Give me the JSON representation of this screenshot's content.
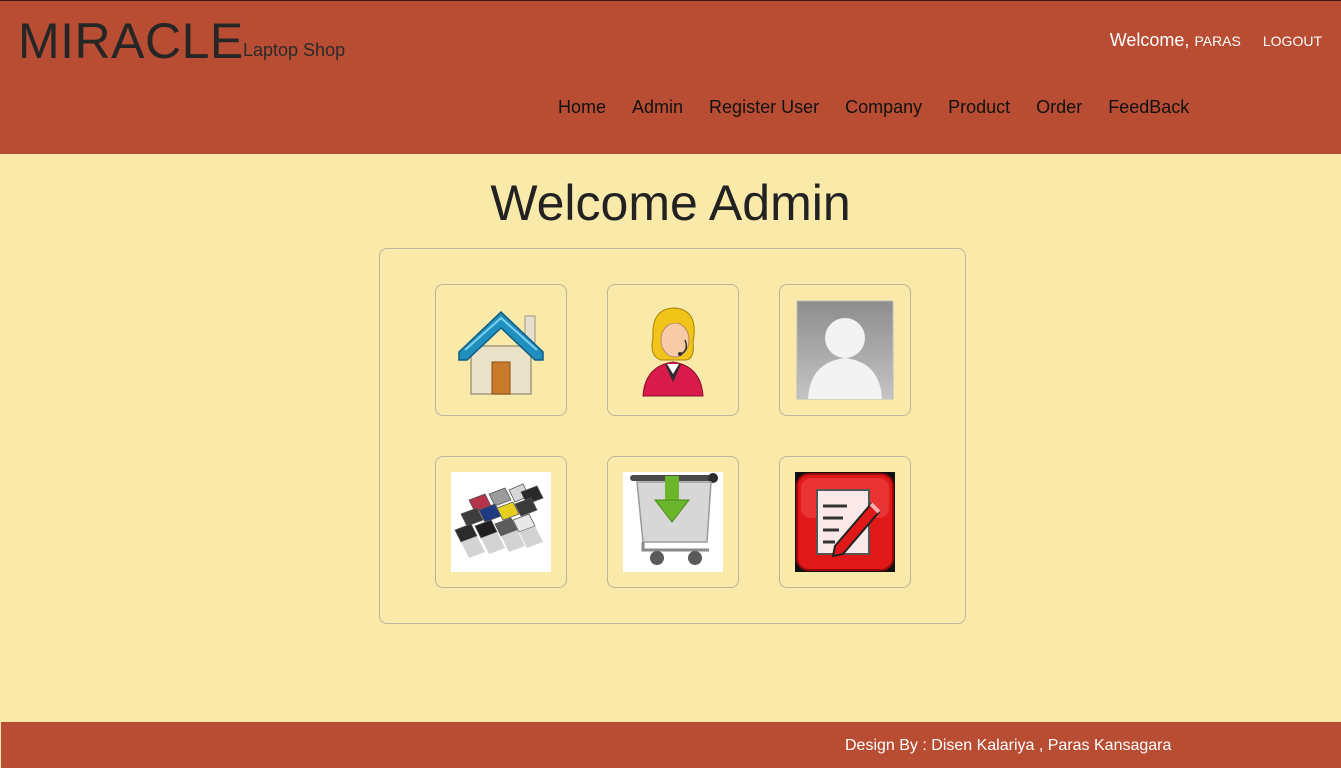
{
  "header": {
    "brand": "MIRACLE",
    "tagline": "Laptop Shop",
    "welcome_label": "Welcome,",
    "username": "PARAS",
    "logout_label": "LOGOUT"
  },
  "nav": {
    "items": [
      {
        "label": "Home"
      },
      {
        "label": "Admin"
      },
      {
        "label": "Register User"
      },
      {
        "label": "Company"
      },
      {
        "label": "Product"
      },
      {
        "label": "Order"
      },
      {
        "label": "FeedBack"
      }
    ]
  },
  "main": {
    "title": "Welcome Admin",
    "tiles": [
      {
        "icon": "home-icon"
      },
      {
        "icon": "admin-support-icon"
      },
      {
        "icon": "user-silhouette-icon"
      },
      {
        "icon": "laptops-icon"
      },
      {
        "icon": "shopping-cart-download-icon"
      },
      {
        "icon": "feedback-edit-icon"
      }
    ]
  },
  "footer": {
    "credits": "Design By : Disen Kalariya , Paras Kansagara"
  },
  "colors": {
    "header_bg": "#b94d33",
    "page_bg": "#f9eaaa",
    "border": "#bdb597"
  }
}
